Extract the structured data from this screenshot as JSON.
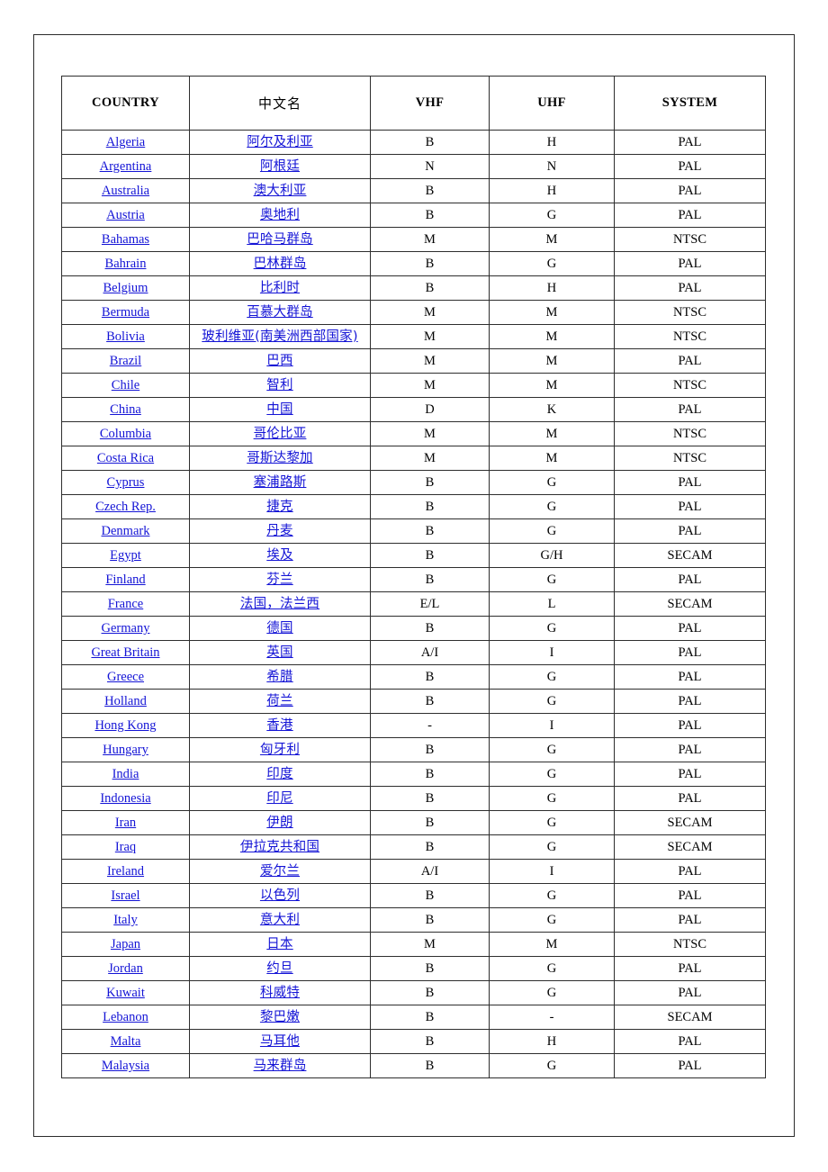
{
  "page": {
    "frame_color": "#2b2b2b",
    "background": "#ffffff",
    "link_color": "#1414d6",
    "border_color": "#2e2e2e"
  },
  "table": {
    "headers": {
      "country": "COUNTRY",
      "chinese": "中文名",
      "vhf": "VHF",
      "uhf": "UHF",
      "system": "SYSTEM"
    },
    "rows": [
      {
        "country": "Algeria",
        "chinese": "阿尔及利亚",
        "vhf": "B",
        "uhf": "H",
        "system": "PAL"
      },
      {
        "country": "Argentina",
        "chinese": "阿根廷",
        "vhf": "N",
        "uhf": "N",
        "system": "PAL"
      },
      {
        "country": "Australia",
        "chinese": "澳大利亚",
        "vhf": "B",
        "uhf": "H",
        "system": "PAL"
      },
      {
        "country": "Austria",
        "chinese": "奥地利",
        "vhf": "B",
        "uhf": "G",
        "system": "PAL"
      },
      {
        "country": "Bahamas",
        "chinese": "巴哈马群岛",
        "vhf": "M",
        "uhf": "M",
        "system": "NTSC"
      },
      {
        "country": "Bahrain",
        "chinese": "巴林群岛",
        "vhf": "B",
        "uhf": "G",
        "system": "PAL"
      },
      {
        "country": "Belgium",
        "chinese": "比利时",
        "vhf": "B",
        "uhf": "H",
        "system": "PAL"
      },
      {
        "country": "Bermuda",
        "chinese": "百慕大群岛",
        "vhf": "M",
        "uhf": "M",
        "system": "NTSC"
      },
      {
        "country": "Bolivia",
        "chinese": "玻利维亚(南美洲西部国家)",
        "vhf": "M",
        "uhf": "M",
        "system": "NTSC"
      },
      {
        "country": "Brazil",
        "chinese": "巴西",
        "vhf": "M",
        "uhf": "M",
        "system": "PAL"
      },
      {
        "country": "Chile",
        "chinese": "智利",
        "vhf": "M",
        "uhf": "M",
        "system": "NTSC"
      },
      {
        "country": "China",
        "chinese": "中国",
        "vhf": "D",
        "uhf": "K",
        "system": "PAL"
      },
      {
        "country": "Columbia",
        "chinese": "哥伦比亚",
        "vhf": "M",
        "uhf": "M",
        "system": "NTSC"
      },
      {
        "country": "Costa Rica",
        "chinese": "哥斯达黎加",
        "vhf": "M",
        "uhf": "M",
        "system": "NTSC"
      },
      {
        "country": "Cyprus",
        "chinese": "塞浦路斯",
        "vhf": "B",
        "uhf": "G",
        "system": "PAL"
      },
      {
        "country": "Czech Rep.",
        "chinese": "捷克",
        "vhf": "B",
        "uhf": "G",
        "system": "PAL"
      },
      {
        "country": "Denmark",
        "chinese": "丹麦",
        "vhf": "B",
        "uhf": "G",
        "system": "PAL"
      },
      {
        "country": "Egypt",
        "chinese": "埃及",
        "vhf": "B",
        "uhf": "G/H",
        "system": "SECAM"
      },
      {
        "country": "Finland",
        "chinese": "芬兰",
        "vhf": "B",
        "uhf": "G",
        "system": "PAL"
      },
      {
        "country": "France",
        "chinese": "法国，法兰西",
        "vhf": "E/L",
        "uhf": "L",
        "system": "SECAM"
      },
      {
        "country": "Germany",
        "chinese": "德国",
        "vhf": "B",
        "uhf": "G",
        "system": "PAL"
      },
      {
        "country": "Great Britain",
        "chinese": "英国",
        "vhf": "A/I",
        "uhf": "I",
        "system": "PAL"
      },
      {
        "country": "Greece",
        "chinese": "希腊",
        "vhf": "B",
        "uhf": "G",
        "system": "PAL"
      },
      {
        "country": "Holland",
        "chinese": "荷兰",
        "vhf": "B",
        "uhf": "G",
        "system": "PAL"
      },
      {
        "country": "Hong Kong",
        "chinese": "香港",
        "vhf": "-",
        "uhf": "I",
        "system": "PAL"
      },
      {
        "country": "Hungary",
        "chinese": "匈牙利",
        "vhf": "B",
        "uhf": "G",
        "system": "PAL"
      },
      {
        "country": "India",
        "chinese": "印度",
        "vhf": "B",
        "uhf": "G",
        "system": "PAL"
      },
      {
        "country": "Indonesia",
        "chinese": "印尼",
        "vhf": "B",
        "uhf": "G",
        "system": "PAL"
      },
      {
        "country": "Iran",
        "chinese": "伊朗",
        "vhf": "B",
        "uhf": "G",
        "system": "SECAM"
      },
      {
        "country": "Iraq",
        "chinese": "伊拉克共和国",
        "vhf": "B",
        "uhf": "G",
        "system": "SECAM"
      },
      {
        "country": "Ireland",
        "chinese": "爱尔兰",
        "vhf": "A/I",
        "uhf": "I",
        "system": "PAL"
      },
      {
        "country": "Israel",
        "chinese": "以色列",
        "vhf": "B",
        "uhf": "G",
        "system": "PAL"
      },
      {
        "country": "Italy",
        "chinese": "意大利",
        "vhf": "B",
        "uhf": "G",
        "system": "PAL"
      },
      {
        "country": "Japan",
        "chinese": "日本",
        "vhf": "M",
        "uhf": "M",
        "system": "NTSC"
      },
      {
        "country": "Jordan",
        "chinese": "约旦",
        "vhf": "B",
        "uhf": "G",
        "system": "PAL"
      },
      {
        "country": "Kuwait",
        "chinese": "科威特",
        "vhf": "B",
        "uhf": "G",
        "system": "PAL"
      },
      {
        "country": "Lebanon",
        "chinese": "黎巴嫩",
        "vhf": "B",
        "uhf": "-",
        "system": "SECAM"
      },
      {
        "country": "Malta",
        "chinese": "马耳他",
        "vhf": "B",
        "uhf": "H",
        "system": "PAL"
      },
      {
        "country": "Malaysia",
        "chinese": "马来群岛",
        "vhf": "B",
        "uhf": "G",
        "system": "PAL"
      }
    ]
  }
}
